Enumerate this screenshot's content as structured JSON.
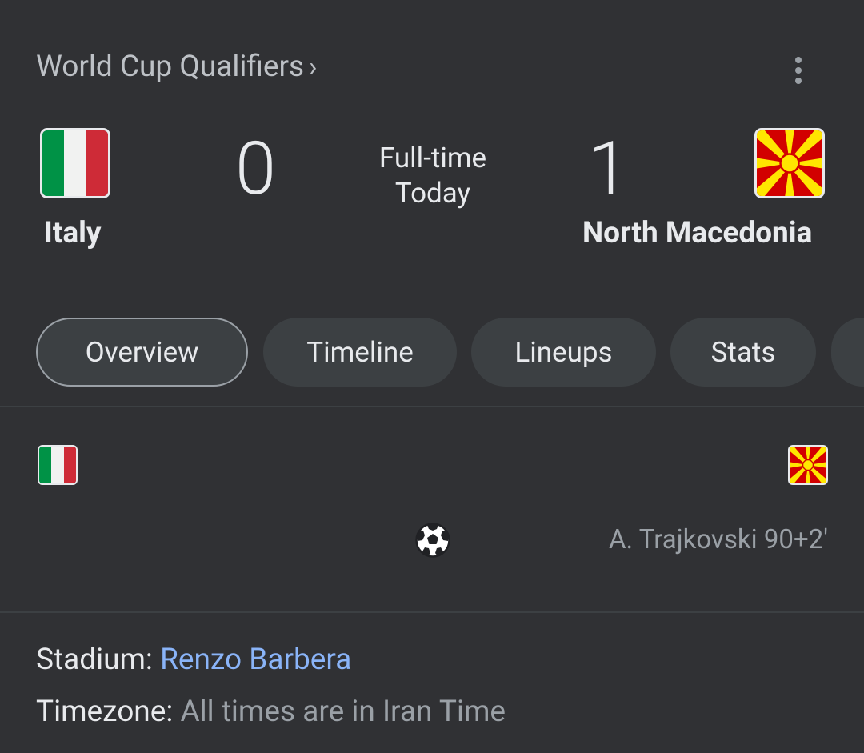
{
  "header": {
    "competition": "World Cup Qualifiers",
    "chevron": "›",
    "more_icon": "more-vert-icon"
  },
  "match": {
    "home": {
      "name": "Italy",
      "score": "0",
      "flag": "italy-flag"
    },
    "away": {
      "name": "North Macedonia",
      "score": "1",
      "flag": "north-macedonia-flag"
    },
    "status": "Full-time",
    "date": "Today"
  },
  "tabs": [
    {
      "label": "Overview",
      "active": true
    },
    {
      "label": "Timeline",
      "active": false
    },
    {
      "label": "Lineups",
      "active": false
    },
    {
      "label": "Stats",
      "active": false
    }
  ],
  "events": [
    {
      "team": "away",
      "type": "goal",
      "icon": "soccer-ball-icon",
      "player": "A. Trajkovski",
      "minute": "90+2'",
      "text": "A. Trajkovski 90+2'"
    }
  ],
  "info": {
    "stadium_label": "Stadium:",
    "stadium_value": "Renzo Barbera",
    "timezone_label": "Timezone:",
    "timezone_value": "All times are in Iran Time"
  },
  "colors": {
    "background": "#303134",
    "tab_background": "#3c4043",
    "link": "#8ab4f8",
    "muted_text": "#9aa0a6"
  }
}
